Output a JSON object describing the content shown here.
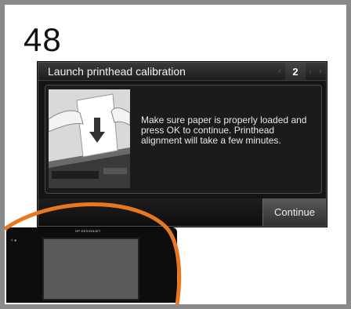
{
  "step": {
    "number": "48"
  },
  "screen": {
    "title": "Launch printhead calibration",
    "pager": {
      "current": "2",
      "prev_icon": "chevron-left-icon",
      "next_icon": "chevron-right-icon"
    },
    "message": "Make sure paper is properly loaded and press OK to continue. Printhead alignment will take a few minutes.",
    "continue_label": "Continue"
  },
  "device": {
    "brand": "HP DESIGNJET"
  },
  "colors": {
    "accent": "#e87722",
    "frame": "#8a8a8a",
    "screen_bg": "#141414"
  }
}
